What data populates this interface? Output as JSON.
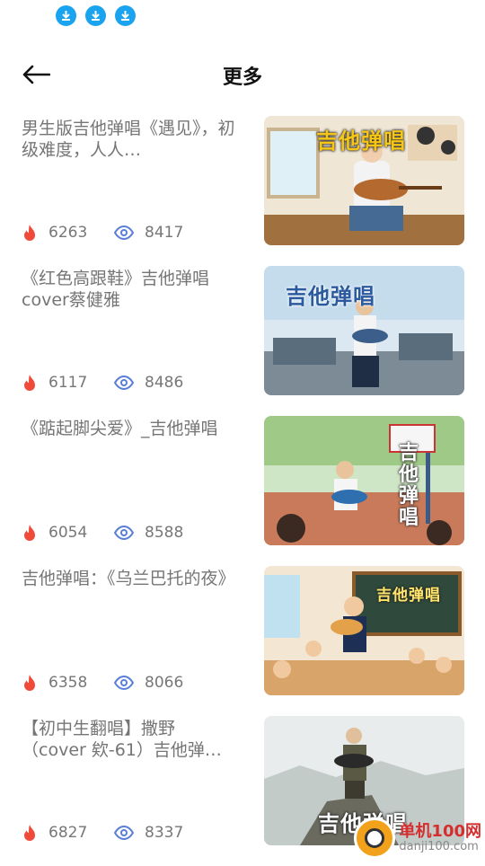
{
  "header": {
    "title": "更多"
  },
  "status_icons": [
    "download-icon",
    "download-icon",
    "download-icon"
  ],
  "colors": {
    "accent": "#1aa3ee",
    "hot": "#f04a3a",
    "view": "#5a7fd6"
  },
  "items": [
    {
      "title": "男生版吉他弹唱《遇见》，初级难度，人人…",
      "hot": "6263",
      "views": "8417",
      "thumb_text": "吉他弹唱"
    },
    {
      "title": "《红色高跟鞋》吉他弹唱cover蔡健雅",
      "hot": "6117",
      "views": "8486",
      "thumb_text": "吉他弹唱"
    },
    {
      "title": "《踮起脚尖爱》_吉他弹唱",
      "hot": "6054",
      "views": "8588",
      "thumb_text": "吉他弹唱"
    },
    {
      "title": "吉他弹唱：《乌兰巴托的夜》",
      "hot": "6358",
      "views": "8066",
      "thumb_text": "吉他弹唱"
    },
    {
      "title": "【初中生翻唱】撒野（cover 欸-61）吉他弹…",
      "hot": "6827",
      "views": "8337",
      "thumb_text": "吉他弹唱"
    }
  ],
  "watermark": {
    "title": "单机100网",
    "url": "danji100.com"
  }
}
